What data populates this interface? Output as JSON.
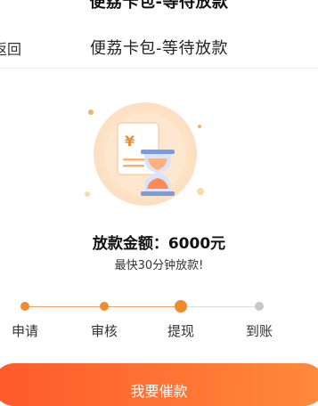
{
  "window": {
    "title": "便荔卡包-等待放款"
  },
  "header": {
    "back_label": "返回",
    "title": "便荔卡包-等待放款"
  },
  "loan": {
    "amount_text": "放款金额：6000元",
    "hint": "最快30分钟放款!"
  },
  "steps": [
    {
      "label": "申请",
      "state": "done"
    },
    {
      "label": "审核",
      "state": "done"
    },
    {
      "label": "提现",
      "state": "current"
    },
    {
      "label": "到账",
      "state": "pending"
    }
  ],
  "cta": {
    "label": "我要催款"
  },
  "colors": {
    "accent": "#f08a2e",
    "button_start": "#ff5a2a",
    "button_end": "#ff8a3c",
    "inactive": "#c8c8c8"
  },
  "icons": [
    "yen-icon",
    "hourglass-icon"
  ]
}
